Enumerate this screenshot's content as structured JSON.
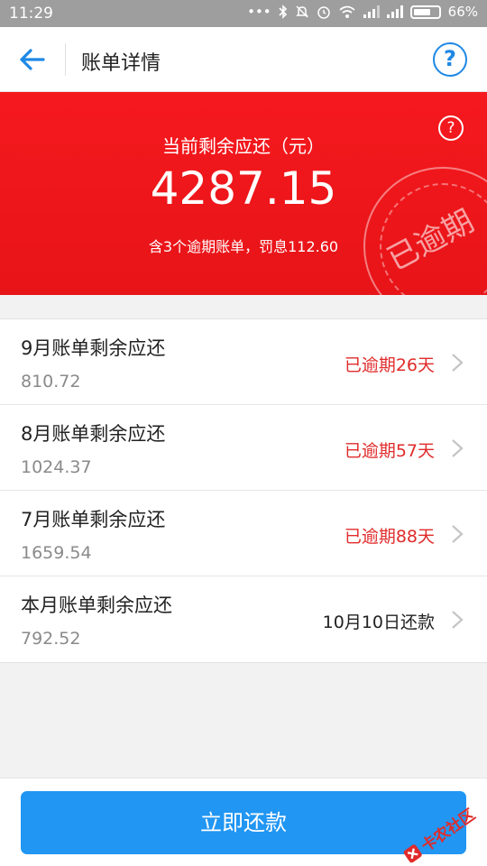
{
  "status_bar": {
    "time": "11:29",
    "battery": "66%",
    "icons": [
      "more-dots-icon",
      "bluetooth-icon",
      "mute-icon",
      "alarm-icon",
      "wifi-icon",
      "signal-icon",
      "signal-icon",
      "battery-icon"
    ]
  },
  "nav": {
    "title": "账单详情",
    "back_icon": "back-arrow-icon",
    "help_icon": "help-icon",
    "help_glyph": "?"
  },
  "hero": {
    "label": "当前剩余应还（元）",
    "amount": "4287.15",
    "subtitle": "含3个逾期账单，罚息112.60",
    "help_glyph": "?",
    "stamp_text": "已逾期",
    "background_color": "#f2191e"
  },
  "bills": [
    {
      "title": "9月账单剩余应还",
      "amount": "810.72",
      "status": "已逾期26天",
      "overdue": true
    },
    {
      "title": "8月账单剩余应还",
      "amount": "1024.37",
      "status": "已逾期57天",
      "overdue": true
    },
    {
      "title": "7月账单剩余应还",
      "amount": "1659.54",
      "status": "已逾期88天",
      "overdue": true
    },
    {
      "title": "本月账单剩余应还",
      "amount": "792.52",
      "status": "10月10日还款",
      "overdue": false
    }
  ],
  "footer": {
    "pay_button_label": "立即还款",
    "watermark_text": "卡农社区"
  },
  "colors": {
    "accent_blue": "#2196f3",
    "overdue_red": "#e02b2b"
  }
}
